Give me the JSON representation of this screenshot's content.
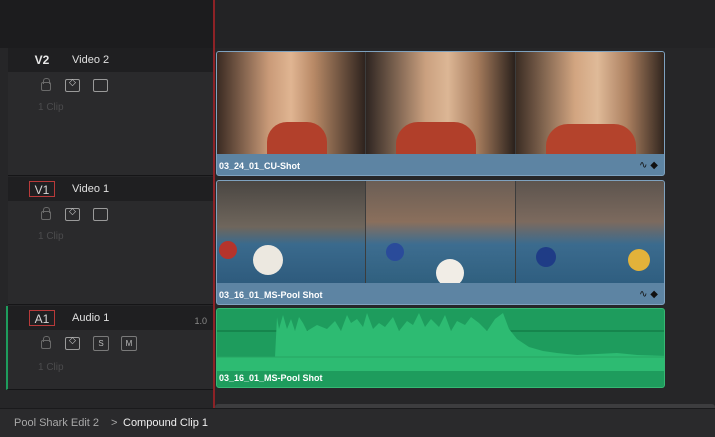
{
  "tracks": [
    {
      "id": "V2",
      "name": "Video 2",
      "clip_count": "1 Clip",
      "type": "video",
      "record_armed": false
    },
    {
      "id": "V1",
      "name": "Video 1",
      "clip_count": "1 Clip",
      "type": "video",
      "record_armed": true
    },
    {
      "id": "A1",
      "name": "Audio 1",
      "clip_count": "1 Clip",
      "type": "audio",
      "record_armed": true,
      "volume": "1.0"
    }
  ],
  "audio_buttons": {
    "solo": "S",
    "mute": "M"
  },
  "clips": {
    "v2": {
      "label": "03_24_01_CU-Shot",
      "icons": "∿ ◆"
    },
    "v1": {
      "label": "03_16_01_MS-Pool Shot",
      "icons": "∿ ◆"
    },
    "a1": {
      "label": "03_16_01_MS-Pool Shot"
    }
  },
  "breadcrumb": {
    "parent": "Pool Shark Edit 2",
    "separator": ">",
    "current": "Compound Clip 1"
  },
  "colors": {
    "video_clip": "#5d84a3",
    "audio_clip": "#1e9c5d",
    "playhead": "#8d2226",
    "record_border": "#b83a3a"
  }
}
